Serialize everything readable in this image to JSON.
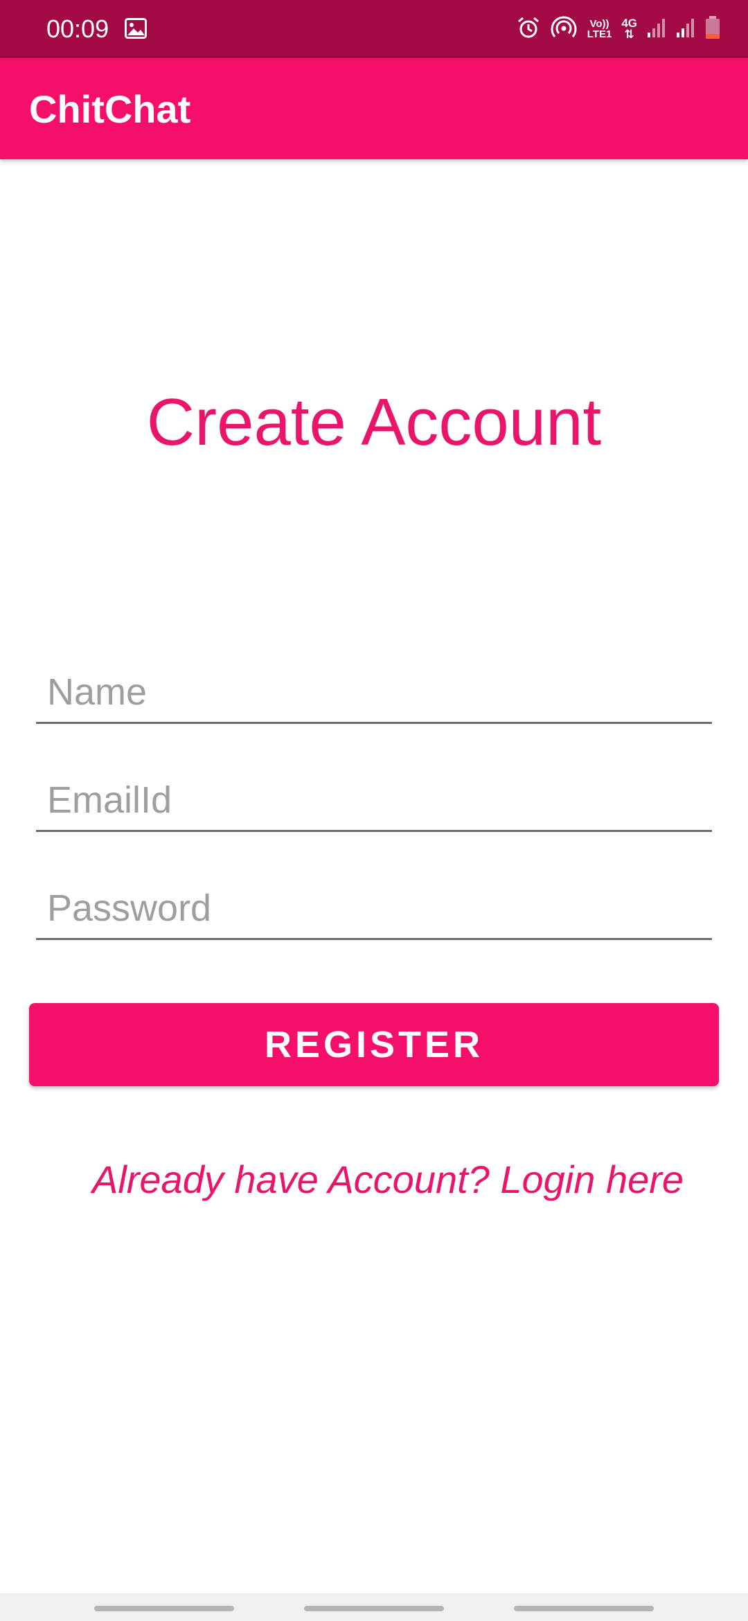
{
  "status_bar": {
    "time": "00:09",
    "volte_line1": "Vo))",
    "volte_line2": "LTE1",
    "network_type": "4G",
    "icons": [
      "gallery-icon",
      "alarm-icon",
      "hotspot-icon",
      "signal-icon",
      "signal-icon",
      "battery-icon"
    ]
  },
  "app_bar": {
    "title": "ChitChat"
  },
  "main": {
    "heading": "Create Account",
    "name_placeholder": "Name",
    "email_placeholder": "EmailId",
    "password_placeholder": "Password",
    "register_label": "REGISTER",
    "login_link": "Already have Account? Login here"
  },
  "colors": {
    "primary": "#f50f6b",
    "primary_dark": "#a10a45",
    "accent_text": "#e8156b"
  }
}
